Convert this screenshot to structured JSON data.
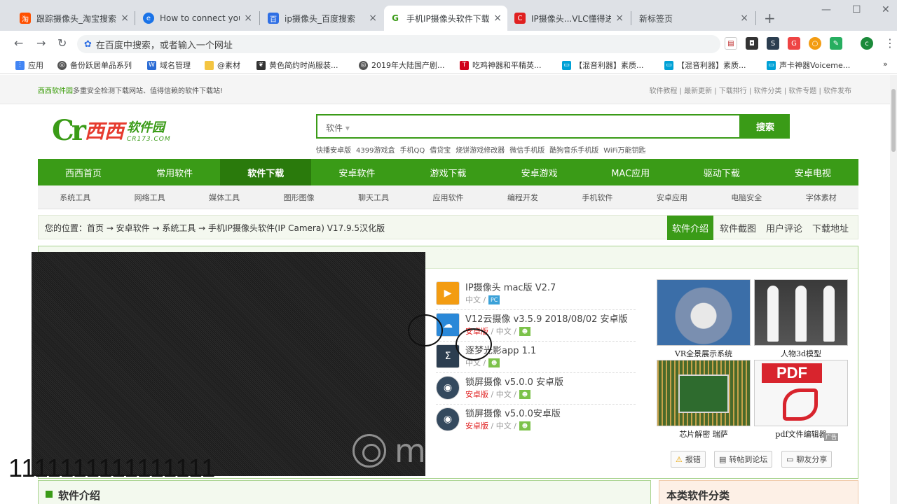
{
  "browser": {
    "tabs": [
      {
        "title": "跟踪摄像头_淘宝搜索",
        "favicon": "taobao-icon",
        "color": "#ff5000",
        "glyph": "淘"
      },
      {
        "title": "How to connect your",
        "favicon": "edge-icon",
        "color": "#1a73e8",
        "glyph": "e"
      },
      {
        "title": "ip摄像头_百度搜索",
        "favicon": "baidu-icon",
        "color": "#2f6fe4",
        "glyph": "百"
      },
      {
        "title": "手机IP摄像头软件下载",
        "favicon": "cr173-icon",
        "color": "#3a9b17",
        "glyph": "G"
      },
      {
        "title": "IP摄像头...VLC懂得进...",
        "favicon": "csdn-icon",
        "color": "#e02020",
        "glyph": "C"
      },
      {
        "title": "新标签页",
        "favicon": "",
        "color": "",
        "glyph": ""
      }
    ],
    "new_tab": "+",
    "omnibox_placeholder": "在百度中搜索，或者输入一个网址",
    "profile_initial": "c",
    "bookmarks": [
      {
        "label": "应用",
        "icon": "apps-icon",
        "color": "#4285f4"
      },
      {
        "label": "备份跃居单品系列",
        "icon": "globe-icon",
        "color": "#555"
      },
      {
        "label": "域名管理",
        "icon": "w-icon",
        "color": "#2a6bd4"
      },
      {
        "label": "@素材",
        "icon": "folder-icon",
        "color": "#f4c542"
      },
      {
        "label": "黄色简约时尚服装...",
        "icon": "leaf-icon",
        "color": "#333"
      },
      {
        "label": "2019年大陆国产剧...",
        "icon": "globe-icon",
        "color": "#555"
      },
      {
        "label": "吃鸡神器和平精英...",
        "icon": "t-icon",
        "color": "#d0021b"
      },
      {
        "label": "【混音利器】素质...",
        "icon": "bilibili-icon",
        "color": "#00a1d6"
      },
      {
        "label": "【混音利器】素质...",
        "icon": "bilibili-icon",
        "color": "#00a1d6"
      },
      {
        "label": "声卡神器Voiceme...",
        "icon": "bilibili-icon",
        "color": "#00a1d6"
      }
    ]
  },
  "site": {
    "top_left_brand": "西西软件园",
    "top_left_text": "多重安全检测下载网站、值得信赖的软件下载站!",
    "top_right_text": "软件教程 | 最新更新 | 下载排行 | 软件分类 | 软件专题 | 软件发布",
    "logo_main": "西西",
    "logo_sub": "软件园",
    "logo_domain": "CR173.COM",
    "search_category": "软件",
    "search_button": "搜索",
    "hot_keywords": [
      "快播安卓版",
      "4399游戏盒",
      "手机QQ",
      "借贷宝",
      "烧饼游戏修改器",
      "微信手机版",
      "酷狗音乐手机版",
      "WiFi万能钥匙"
    ],
    "main_nav": [
      "西西首页",
      "常用软件",
      "软件下载",
      "安卓软件",
      "游戏下载",
      "安卓游戏",
      "MAC应用",
      "驱动下载",
      "安卓电视"
    ],
    "main_nav_active": "软件下载",
    "sub_nav": [
      "系统工具",
      "网络工具",
      "媒体工具",
      "图形图像",
      "聊天工具",
      "应用软件",
      "编程开发",
      "手机软件",
      "安卓应用",
      "电脑安全",
      "字体素材"
    ],
    "breadcrumb": "您的位置：首页 → 安卓软件 → 系统工具 → 手机IP摄像头软件(IP Camera) V17.9.5汉化版",
    "content_tabs": [
      "软件介绍",
      "软件截图",
      "用户评论",
      "下载地址"
    ],
    "content_tab_active": "软件介绍",
    "related_apps": [
      {
        "name": "IP摄像头 mac版 V2.7",
        "meta": "中文",
        "platform": "",
        "badge": "PC",
        "icon_color": "#f39c12"
      },
      {
        "name": "V12云摄像 v3.5.9 2018/08/02 安卓版",
        "meta": "中文",
        "platform": "安卓版",
        "badge": "android",
        "icon_color": "#2a88d8"
      },
      {
        "name": "逐梦光影app 1.1",
        "meta": "中文",
        "platform": "",
        "badge": "android",
        "icon_color": "#2c3e50"
      },
      {
        "name": "锁屏摄像 v5.0.0 安卓版",
        "meta": "中文",
        "platform": "安卓版",
        "badge": "android",
        "icon_color": "#34495e"
      },
      {
        "name": "锁屏摄像 v5.0.0安卓版",
        "meta": "中文",
        "platform": "安卓版",
        "badge": "android",
        "icon_color": "#34495e"
      }
    ],
    "ads": [
      {
        "caption": "VR全景展示系统"
      },
      {
        "caption": "人物3d模型"
      },
      {
        "caption": "芯片解密 瑞萨"
      },
      {
        "caption": "pdf文件编辑器"
      }
    ],
    "ad_label": "广告",
    "share_buttons": [
      "报错",
      "转帖到论坛",
      "聊友分享"
    ],
    "intro_title": "软件介绍",
    "category_title": "本类软件分类"
  },
  "video_overlay": {
    "number_text": "1111111111111111",
    "watermark": "m"
  }
}
